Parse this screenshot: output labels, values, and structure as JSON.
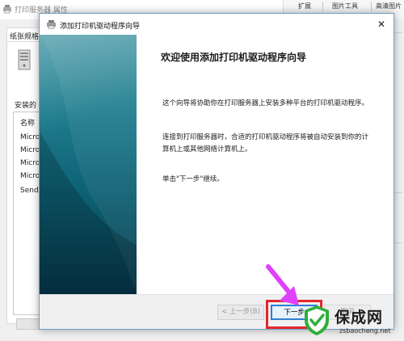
{
  "background_window": {
    "title": "打印服务器 属性",
    "toolbar": {
      "item1": "扩展",
      "item2": "图片工具",
      "item3": "高清图片"
    },
    "tab": "纸张规格",
    "forms_label": "安装的",
    "list": {
      "header": "名称",
      "items": [
        "Micro",
        "Micro",
        "Micro",
        "Micro",
        "Send"
      ]
    }
  },
  "wizard": {
    "title": "添加打印机驱动程序向导",
    "heading": "欢迎使用添加打印机驱动程序向导",
    "paragraph1": "这个向导将协助你在打印服务器上安装多种平台的打印机驱动程序。",
    "paragraph2": "连接到打印服务器时，合适的打印机驱动程序将被自动安装到你的计算机上或其他网络计算机上。",
    "paragraph3": "单击\"下一步\"继续。",
    "buttons": {
      "back": "< 上一步(B)",
      "next": "下一步",
      "cancel": "取消"
    }
  },
  "watermark": {
    "title": "保成网",
    "url": "zsbaocheng.net"
  },
  "colors": {
    "highlight": "#e4262d",
    "arrow": "#e040fb",
    "banner_top": "#4b9aa8",
    "banner_bottom": "#06384a",
    "watermark_green": "#2fae3a"
  },
  "icons": {
    "title_icon": "printer-icon",
    "server_icon": "server-icon",
    "close_icon": "close-icon",
    "pointer_arrow": "arrow-icon"
  }
}
